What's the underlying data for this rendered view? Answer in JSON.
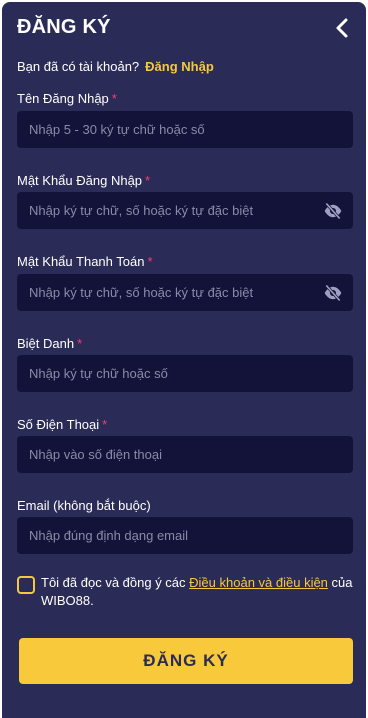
{
  "header": {
    "title": "ĐĂNG KÝ",
    "back_icon": "chevron-left-icon"
  },
  "login_prompt": {
    "text": "Bạn đã có tài khoản?",
    "link": "Đăng Nhập"
  },
  "fields": {
    "username": {
      "label": "Tên Đăng Nhập",
      "required": "*",
      "placeholder": "Nhập 5 - 30 ký tự chữ hoặc số"
    },
    "password": {
      "label": "Mật Khẩu Đăng Nhập",
      "required": "*",
      "placeholder": "Nhập ký tự chữ, số hoặc ký tự đặc biệt",
      "toggle_icon": "eye-off-icon"
    },
    "payment_password": {
      "label": "Mật Khẩu Thanh Toán",
      "required": "*",
      "placeholder": "Nhập ký tự chữ, số hoặc ký tự đặc biệt",
      "toggle_icon": "eye-off-icon"
    },
    "nickname": {
      "label": "Biệt Danh",
      "required": "*",
      "placeholder": "Nhập ký tự chữ hoặc số"
    },
    "phone": {
      "label": "Số Điện Thoại",
      "required": "*",
      "placeholder": "Nhập vào số điện thoại"
    },
    "email": {
      "label": "Email (không bắt buộc)",
      "placeholder": "Nhập đúng định dạng email"
    }
  },
  "agreement": {
    "prefix": "Tôi đã đọc và đồng ý các",
    "terms_link": "Điều khoản và điều kiện",
    "suffix": "của WIBO88."
  },
  "submit_label": "ĐĂNG KÝ",
  "colors": {
    "background": "#2b2b57",
    "field": "#13133a",
    "accent": "#f5c842",
    "required": "#ff3b6b"
  }
}
